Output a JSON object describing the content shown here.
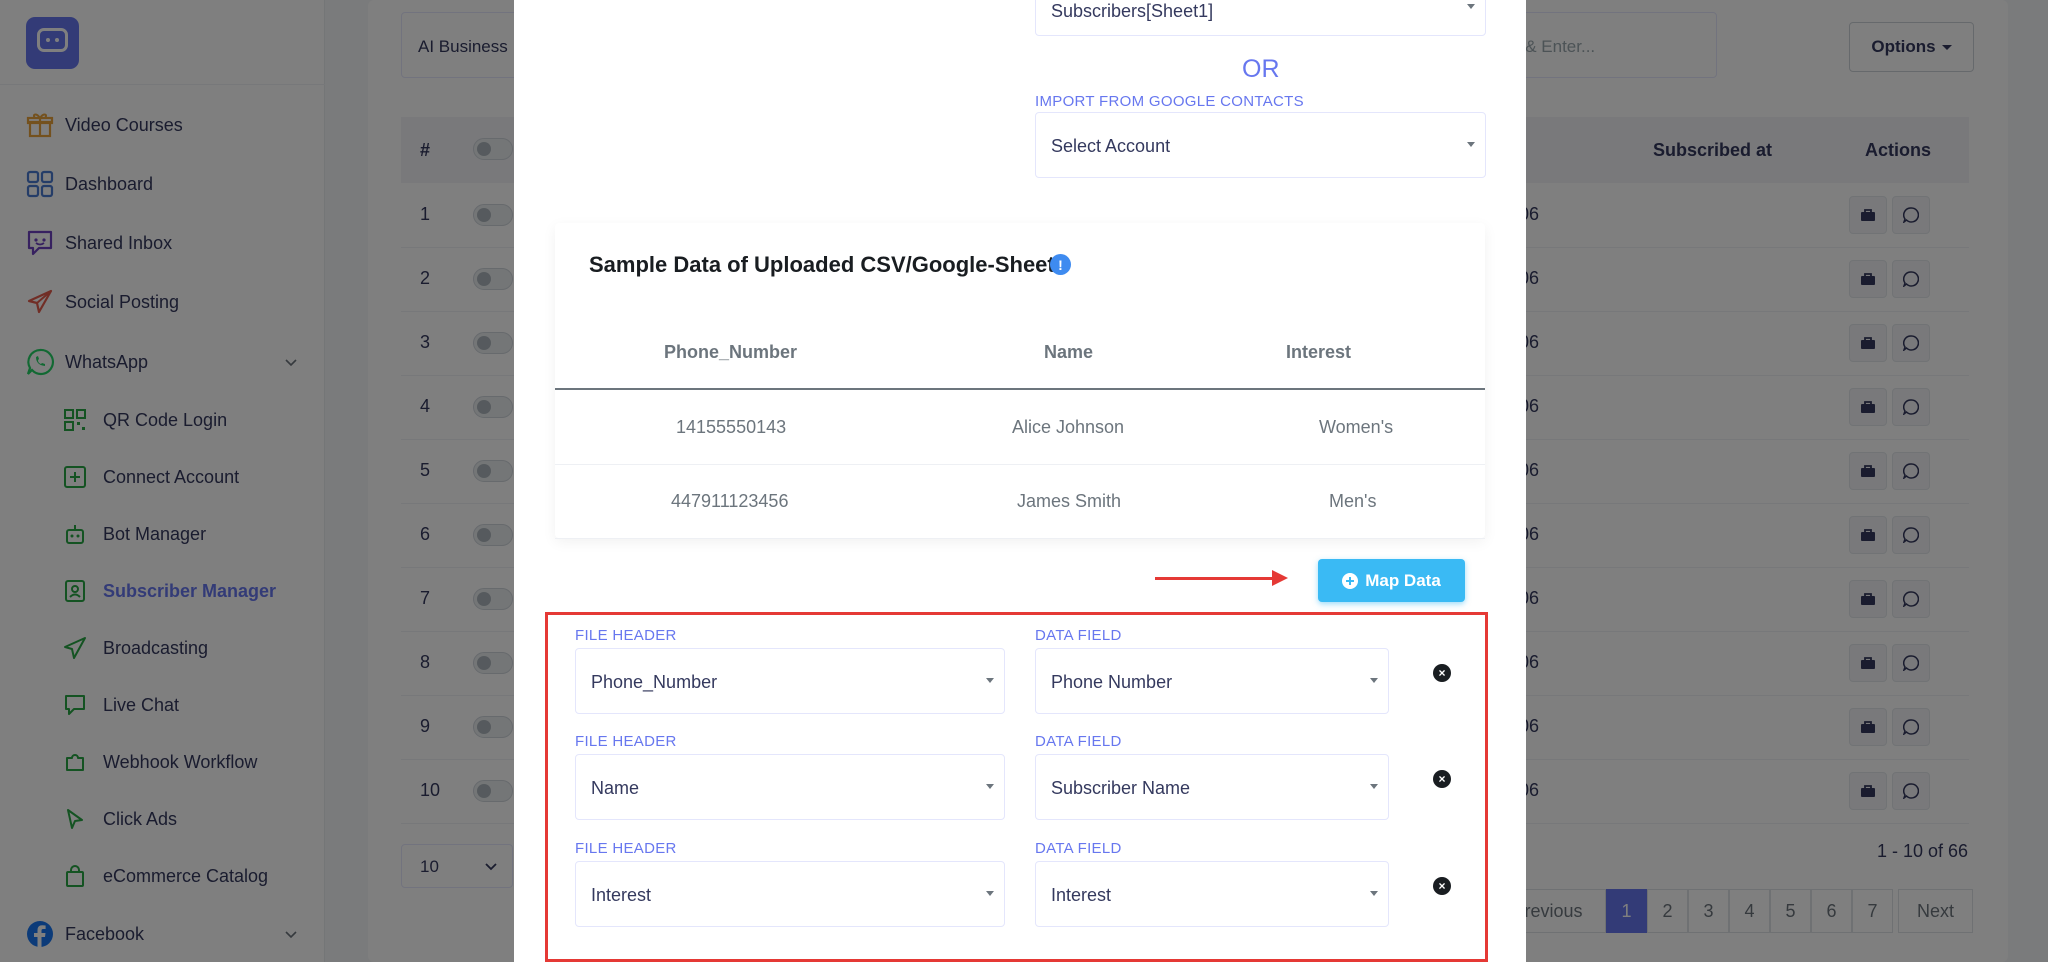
{
  "sidebar": {
    "items": [
      {
        "label": "Video Courses",
        "icon": "gift-icon",
        "color": "#e8a33d"
      },
      {
        "label": "Dashboard",
        "icon": "grid-icon",
        "color": "#4a7bd0"
      },
      {
        "label": "Shared Inbox",
        "icon": "chat-bubble-icon",
        "color": "#6f42c1"
      },
      {
        "label": "Social Posting",
        "icon": "paper-plane-icon",
        "color": "#e25c4c"
      },
      {
        "label": "WhatsApp",
        "icon": "whatsapp-icon",
        "color": "#25d366"
      }
    ],
    "whatsapp_sub": [
      {
        "label": "QR Code Login"
      },
      {
        "label": "Connect Account"
      },
      {
        "label": "Bot Manager"
      },
      {
        "label": "Subscriber Manager",
        "active": true
      },
      {
        "label": "Broadcasting"
      },
      {
        "label": "Live Chat"
      },
      {
        "label": "Webhook Workflow"
      },
      {
        "label": "Click Ads"
      },
      {
        "label": "eCommerce Catalog"
      }
    ],
    "facebook": {
      "label": "Facebook",
      "icon": "facebook-icon",
      "color": "#1877f2"
    }
  },
  "main": {
    "filter_left": "AI Business",
    "search_placeholder": "s & Enter...",
    "options_label": "Options",
    "table_headers": {
      "hash": "#",
      "subscribed_at": "Subscribed at",
      "actions": "Actions"
    },
    "rows": [
      {
        "num": "1",
        "date": "06"
      },
      {
        "num": "2",
        "date": "06"
      },
      {
        "num": "3",
        "date": "06"
      },
      {
        "num": "4",
        "date": "06"
      },
      {
        "num": "5",
        "date": "06"
      },
      {
        "num": "6",
        "date": "06"
      },
      {
        "num": "7",
        "date": "06"
      },
      {
        "num": "8",
        "date": "06"
      },
      {
        "num": "9",
        "date": "06"
      },
      {
        "num": "10",
        "date": "06"
      }
    ],
    "per_page": "10",
    "page_info": "1 - 10 of 66",
    "pagination": [
      "revious",
      "1",
      "2",
      "3",
      "4",
      "5",
      "6",
      "7",
      "Next"
    ]
  },
  "modal": {
    "sheet_select_value": "Subscribers[Sheet1]",
    "or_text": "OR",
    "google_label": "IMPORT FROM GOOGLE CONTACTS",
    "google_select_value": "Select Account",
    "sample_title": "Sample Data of Uploaded CSV/Google-Sheet",
    "info_icon_glyph": "!",
    "sample_table": {
      "headers": [
        "Phone_Number",
        "Name",
        "Interest"
      ],
      "rows": [
        [
          "14155550143",
          "Alice Johnson",
          "Women's"
        ],
        [
          "447911123456",
          "James Smith",
          "Men's"
        ]
      ]
    },
    "map_button_label": "Map Data",
    "mappings": [
      {
        "file_header_label": "FILE HEADER",
        "file_header": "Phone_Number",
        "data_field_label": "DATA FIELD",
        "data_field": "Phone Number"
      },
      {
        "file_header_label": "FILE HEADER",
        "file_header": "Name",
        "data_field_label": "DATA FIELD",
        "data_field": "Subscriber Name"
      },
      {
        "file_header_label": "FILE HEADER",
        "file_header": "Interest",
        "data_field_label": "DATA FIELD",
        "data_field": "Interest"
      }
    ],
    "highlight_color": "#e53935"
  }
}
